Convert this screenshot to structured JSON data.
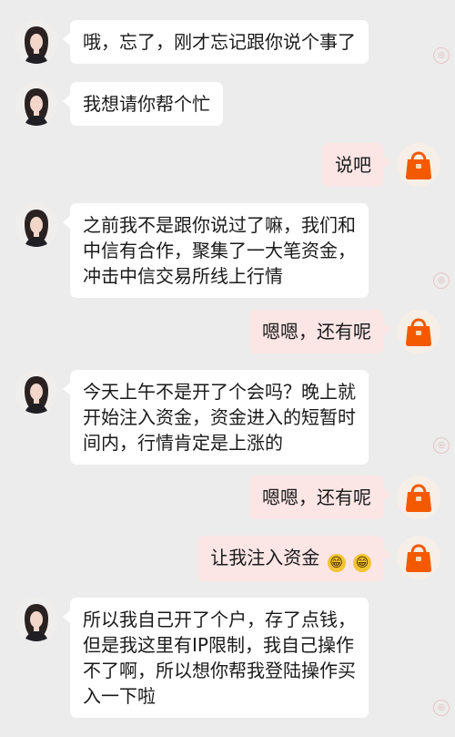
{
  "chat": {
    "messages": [
      {
        "side": "left",
        "lines": [
          "哦，忘了，刚才忘记跟你说个事了"
        ]
      },
      {
        "side": "left",
        "lines": [
          "我想请你帮个忙"
        ]
      },
      {
        "side": "right",
        "lines": [
          "说吧"
        ]
      },
      {
        "side": "left",
        "lines": [
          "之前我不是跟你说过了嘛，我们和",
          "中信有合作，聚集了一大笔资金，",
          "冲击中信交易所线上行情"
        ]
      },
      {
        "side": "right",
        "lines": [
          "嗯嗯，还有呢"
        ]
      },
      {
        "side": "left",
        "lines": [
          "今天上午不是开了个会吗？晚上就",
          "开始注入资金，资金进入的短暂时",
          "间内，行情肯定是上涨的"
        ]
      },
      {
        "side": "right",
        "lines": [
          "嗯嗯，还有呢"
        ]
      },
      {
        "side": "right",
        "lines": [
          "让我注入资金"
        ],
        "emojis": [
          "😁",
          "😁"
        ]
      },
      {
        "side": "left",
        "lines": [
          "所以我自己开了个户，存了点钱，",
          "但是我这里有IP限制，我自己操作",
          "不了啊，所以想你帮我登陆操作买",
          "入一下啦"
        ]
      }
    ],
    "icons": {
      "left_avatar": "woman-portrait-avatar",
      "right_avatar": "orange-handbag-icon",
      "watermark": "circular-watermark-icon"
    }
  },
  "colors": {
    "background": "#ececec",
    "left_bubble": "#ffffff",
    "right_bubble": "#fbe5e5",
    "text": "#1a1a1a",
    "bag_orange": "#f35a00"
  }
}
